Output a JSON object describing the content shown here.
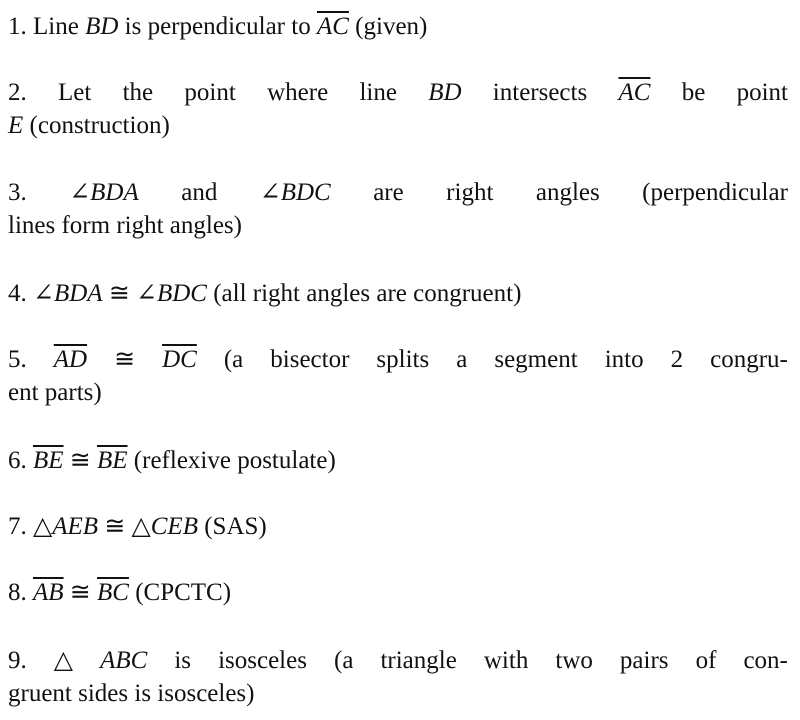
{
  "document": {
    "steps": [
      {
        "number": "1.",
        "statement_text": "Line BD is perpendicular to AC",
        "reason": "given",
        "lines": [
          [
            {
              "t": "1. Line "
            },
            {
              "m": "BD"
            },
            {
              "t": " is perpendicular to "
            },
            {
              "o": "AC"
            },
            {
              "t": " (given)"
            }
          ]
        ]
      },
      {
        "number": "2.",
        "statement_text": "Let the point where line BD intersects AC be point E",
        "reason": "construction",
        "lines": [
          [
            {
              "t": "2."
            },
            {
              "t": "Let"
            },
            {
              "t": "the"
            },
            {
              "t": "point"
            },
            {
              "t": "where"
            },
            {
              "t": "line"
            },
            {
              "m": "BD"
            },
            {
              "t": "intersects"
            },
            {
              "o": "AC"
            },
            {
              "t": "be"
            },
            {
              "t": "point"
            }
          ],
          [
            {
              "m": "E"
            },
            {
              "t": " (construction)"
            }
          ]
        ]
      },
      {
        "number": "3.",
        "statement_text": "∠BDA and ∠BDC are right angles",
        "reason": "perpendicular lines form right angles",
        "lines": [
          [
            {
              "t": "3."
            },
            {
              "m": "∠BDA"
            },
            {
              "t": "and"
            },
            {
              "m": "∠BDC"
            },
            {
              "t": "are"
            },
            {
              "t": "right"
            },
            {
              "t": "angles"
            },
            {
              "t": "(perpendicular"
            }
          ],
          [
            {
              "t": "lines form right angles)"
            }
          ]
        ]
      },
      {
        "number": "4.",
        "statement_text": "∠BDA ≅ ∠BDC",
        "reason": "all right angles are congruent",
        "lines": [
          [
            {
              "t": "4. "
            },
            {
              "m": "∠BDA"
            },
            {
              "t": " ≅ "
            },
            {
              "m": "∠BDC"
            },
            {
              "t": " (all right angles are congruent)"
            }
          ]
        ]
      },
      {
        "number": "5.",
        "statement_text": "AD ≅ DC",
        "reason": "a bisector splits a segment into 2 congruent parts",
        "lines": [
          [
            {
              "t": "5."
            },
            {
              "o": "AD"
            },
            {
              "t": "≅"
            },
            {
              "o": "DC"
            },
            {
              "t": "(a"
            },
            {
              "t": "bisector"
            },
            {
              "t": "splits"
            },
            {
              "t": "a"
            },
            {
              "t": "segment"
            },
            {
              "t": "into"
            },
            {
              "t": "2"
            },
            {
              "t": "congru-"
            }
          ],
          [
            {
              "t": "ent parts)"
            }
          ]
        ]
      },
      {
        "number": "6.",
        "statement_text": "BE ≅ BE",
        "reason": "reflexive postulate",
        "lines": [
          [
            {
              "t": "6. "
            },
            {
              "o": "BE"
            },
            {
              "t": " ≅ "
            },
            {
              "o": "BE"
            },
            {
              "t": " (reflexive postulate)"
            }
          ]
        ]
      },
      {
        "number": "7.",
        "statement_text": "△AEB ≅ △CEB",
        "reason": "SAS",
        "lines": [
          [
            {
              "t": "7. △"
            },
            {
              "m": "AEB"
            },
            {
              "t": " ≅ △"
            },
            {
              "m": "CEB"
            },
            {
              "t": " (SAS)"
            }
          ]
        ]
      },
      {
        "number": "8.",
        "statement_text": "AB ≅ BC",
        "reason": "CPCTC",
        "lines": [
          [
            {
              "t": "8. "
            },
            {
              "o": "AB"
            },
            {
              "t": " ≅ "
            },
            {
              "o": "BC"
            },
            {
              "t": " (CPCTC)"
            }
          ]
        ]
      },
      {
        "number": "9.",
        "statement_text": "△ABC is isosceles",
        "reason": "a triangle with two pairs of congruent sides is isosceles",
        "lines": [
          [
            {
              "t": "9."
            },
            {
              "t": "△"
            },
            {
              "m": "ABC"
            },
            {
              "t": "is"
            },
            {
              "t": "isosceles"
            },
            {
              "t": "(a"
            },
            {
              "t": "triangle"
            },
            {
              "t": "with"
            },
            {
              "t": "two"
            },
            {
              "t": "pairs"
            },
            {
              "t": "of"
            },
            {
              "t": "con-"
            }
          ],
          [
            {
              "t": "gruent sides is isosceles)"
            }
          ]
        ]
      }
    ]
  }
}
